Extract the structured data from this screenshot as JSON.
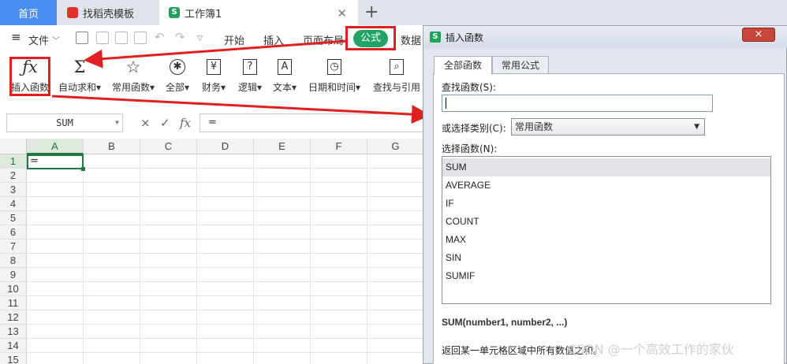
{
  "tabs": {
    "home": "首页",
    "template": "找稻壳模板",
    "workbook": "工作簿1",
    "add": "+"
  },
  "menu": {
    "file": "文件",
    "start": "开始",
    "insert": "插入",
    "page_layout": "页面布局",
    "formula": "公式",
    "data": "数据"
  },
  "ribbon": [
    {
      "label": "插入函数",
      "glyph": "ƒx"
    },
    {
      "label": "自动求和",
      "glyph": "Σ"
    },
    {
      "label": "常用函数",
      "glyph": "☆"
    },
    {
      "label": "全部",
      "glyph": "✱"
    },
    {
      "label": "财务",
      "glyph": "¥"
    },
    {
      "label": "逻辑",
      "glyph": "?"
    },
    {
      "label": "文本",
      "glyph": "A"
    },
    {
      "label": "日期和时间",
      "glyph": "◷"
    },
    {
      "label": "查找与引用",
      "glyph": "⌕"
    }
  ],
  "formula_bar": {
    "name_box": "SUM",
    "fx": "fx",
    "cancel": "×",
    "confirm": "✓",
    "content": "="
  },
  "sheet": {
    "columns": [
      "A",
      "B",
      "C",
      "D",
      "E",
      "F",
      "G"
    ],
    "rows": [
      "1",
      "2",
      "3",
      "4",
      "5",
      "6",
      "7",
      "8",
      "9",
      "10",
      "11",
      "12",
      "13",
      "14",
      "15"
    ],
    "active_cell_value": "="
  },
  "dialog": {
    "title": "插入函数",
    "close": "×",
    "tab_all": "全部函数",
    "tab_common": "常用公式",
    "search_label": "查找函数(S):",
    "category_label": "或选择类别(C):",
    "category_value": "常用函数",
    "select_label": "选择函数(N):",
    "functions": [
      "SUM",
      "AVERAGE",
      "IF",
      "COUNT",
      "MAX",
      "SIN",
      "SUMIF"
    ],
    "signature": "SUM(number1, number2, ...)",
    "description": "返回某一单元格区域中所有数值之和。"
  },
  "watermark": "CSDN @一个高效工作的家伙",
  "colors": {
    "accent_green": "#21a366",
    "highlight_red": "#e02020",
    "tab_blue": "#4a8df0"
  }
}
